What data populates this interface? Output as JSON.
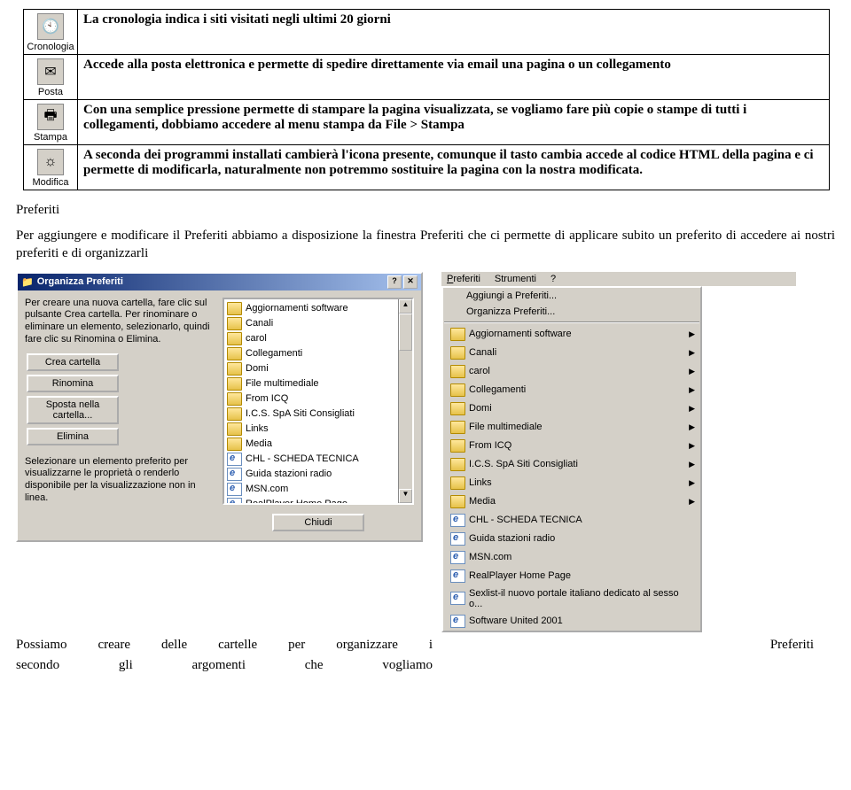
{
  "toolbar_rows": [
    {
      "icon": "🕙",
      "label": "Cronologia",
      "desc": "La cronologia indica i siti visitati negli ultimi 20 giorni"
    },
    {
      "icon": "✉",
      "label": "Posta",
      "desc": "Accede alla posta elettronica e permette di spedire direttamente via email una pagina o un collegamento"
    },
    {
      "icon": "🖶",
      "label": "Stampa",
      "desc": "Con una semplice pressione permette di stampare la pagina visualizzata, se vogliamo fare più copie o stampe di tutti i collegamenti, dobbiamo accedere al menu stampa  da File > Stampa"
    },
    {
      "icon": "☼",
      "label": "Modifica",
      "desc": "A seconda dei programmi installati cambierà l'icona presente, comunque il tasto cambia accede al codice HTML della pagina e ci permette di modificarla, naturalmente non potremmo sostituire la pagina con la nostra modificata."
    }
  ],
  "section_title": "Preferiti",
  "body_para": "Per aggiungere e modificare il Preferiti abbiamo a disposizione la finestra Preferiti che ci permette di applicare subito un preferito di accedere ai nostri preferiti e di organizzarli",
  "organize": {
    "title": "Organizza Preferiti",
    "instr1": "Per creare una nuova cartella, fare clic sul pulsante Crea cartella. Per rinominare o eliminare un elemento, selezionarlo, quindi fare clic su Rinomina o Elimina.",
    "btn_create": "Crea cartella",
    "btn_rename": "Rinomina",
    "btn_move": "Sposta nella cartella...",
    "btn_delete": "Elimina",
    "instr2": "Selezionare un elemento preferito per visualizzarne le proprietà o renderlo disponibile per la visualizzazione non in linea.",
    "btn_close": "Chiudi",
    "items": [
      {
        "t": "folder",
        "label": "Aggiornamenti software"
      },
      {
        "t": "folder",
        "label": "Canali"
      },
      {
        "t": "folder",
        "label": "carol"
      },
      {
        "t": "folder",
        "label": "Collegamenti"
      },
      {
        "t": "folder",
        "label": "Domi"
      },
      {
        "t": "folder",
        "label": "File multimediale"
      },
      {
        "t": "folder",
        "label": "From ICQ"
      },
      {
        "t": "folder",
        "label": "I.C.S. SpA Siti Consigliati"
      },
      {
        "t": "folder",
        "label": "Links"
      },
      {
        "t": "folder",
        "label": "Media"
      },
      {
        "t": "ie",
        "label": "CHL - SCHEDA TECNICA"
      },
      {
        "t": "ie",
        "label": "Guida stazioni radio"
      },
      {
        "t": "ie",
        "label": "MSN.com"
      },
      {
        "t": "ie",
        "label": "RealPlayer Home Page"
      }
    ]
  },
  "menu": {
    "bar": {
      "favorites": "Preferiti",
      "tools": "Strumenti",
      "help": "?"
    },
    "add": "Aggiungi a Preferiti...",
    "org": "Organizza Preferiti...",
    "items": [
      {
        "t": "folder",
        "label": "Aggiornamenti software",
        "sub": true
      },
      {
        "t": "folder",
        "label": "Canali",
        "sub": true
      },
      {
        "t": "folder",
        "label": "carol",
        "sub": true
      },
      {
        "t": "folder",
        "label": "Collegamenti",
        "sub": true
      },
      {
        "t": "folder",
        "label": "Domi",
        "sub": true
      },
      {
        "t": "folder",
        "label": "File multimediale",
        "sub": true
      },
      {
        "t": "folder",
        "label": "From ICQ",
        "sub": true
      },
      {
        "t": "folder",
        "label": "I.C.S. SpA Siti Consigliati",
        "sub": true
      },
      {
        "t": "folder",
        "label": "Links",
        "sub": true
      },
      {
        "t": "folder",
        "label": "Media",
        "sub": true
      },
      {
        "t": "ie",
        "label": "CHL - SCHEDA TECNICA",
        "sub": false
      },
      {
        "t": "ie",
        "label": "Guida stazioni radio",
        "sub": false
      },
      {
        "t": "ie",
        "label": "MSN.com",
        "sub": false
      },
      {
        "t": "ie",
        "label": "RealPlayer Home Page",
        "sub": false
      },
      {
        "t": "ie",
        "label": "Sexlist-il nuovo portale italiano dedicato al sesso o...",
        "sub": false
      },
      {
        "t": "ie",
        "label": "Software United 2001",
        "sub": false
      }
    ]
  },
  "footer": {
    "line1_left": "Possiamo  creare  delle  cartelle  per  organizzare  i",
    "line1_right": "Preferiti",
    "line2": "secondo     gli     argomenti     che     vogliamo"
  }
}
